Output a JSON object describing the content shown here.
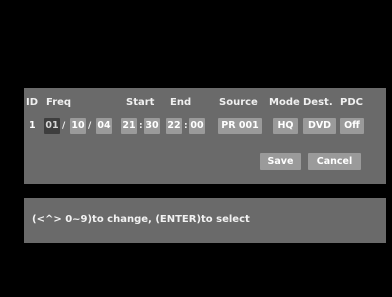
{
  "columns": {
    "id": "ID",
    "freq": "Freq",
    "start": "Start",
    "end": "End",
    "source": "Source",
    "mode": "Mode",
    "dest": "Dest.",
    "pdc": "PDC"
  },
  "entry": {
    "id": "1",
    "day": "01",
    "month": "10",
    "year": "04",
    "date_sep": "/",
    "start_hour": "21",
    "start_min": "30",
    "end_hour": "22",
    "end_min": "00",
    "time_sep": ":",
    "source": "PR 001",
    "mode": "HQ",
    "dest": "DVD",
    "pdc": "Off"
  },
  "buttons": {
    "save": "Save",
    "cancel": "Cancel"
  },
  "hint": "(<^> 0~9)to change, (ENTER)to select"
}
